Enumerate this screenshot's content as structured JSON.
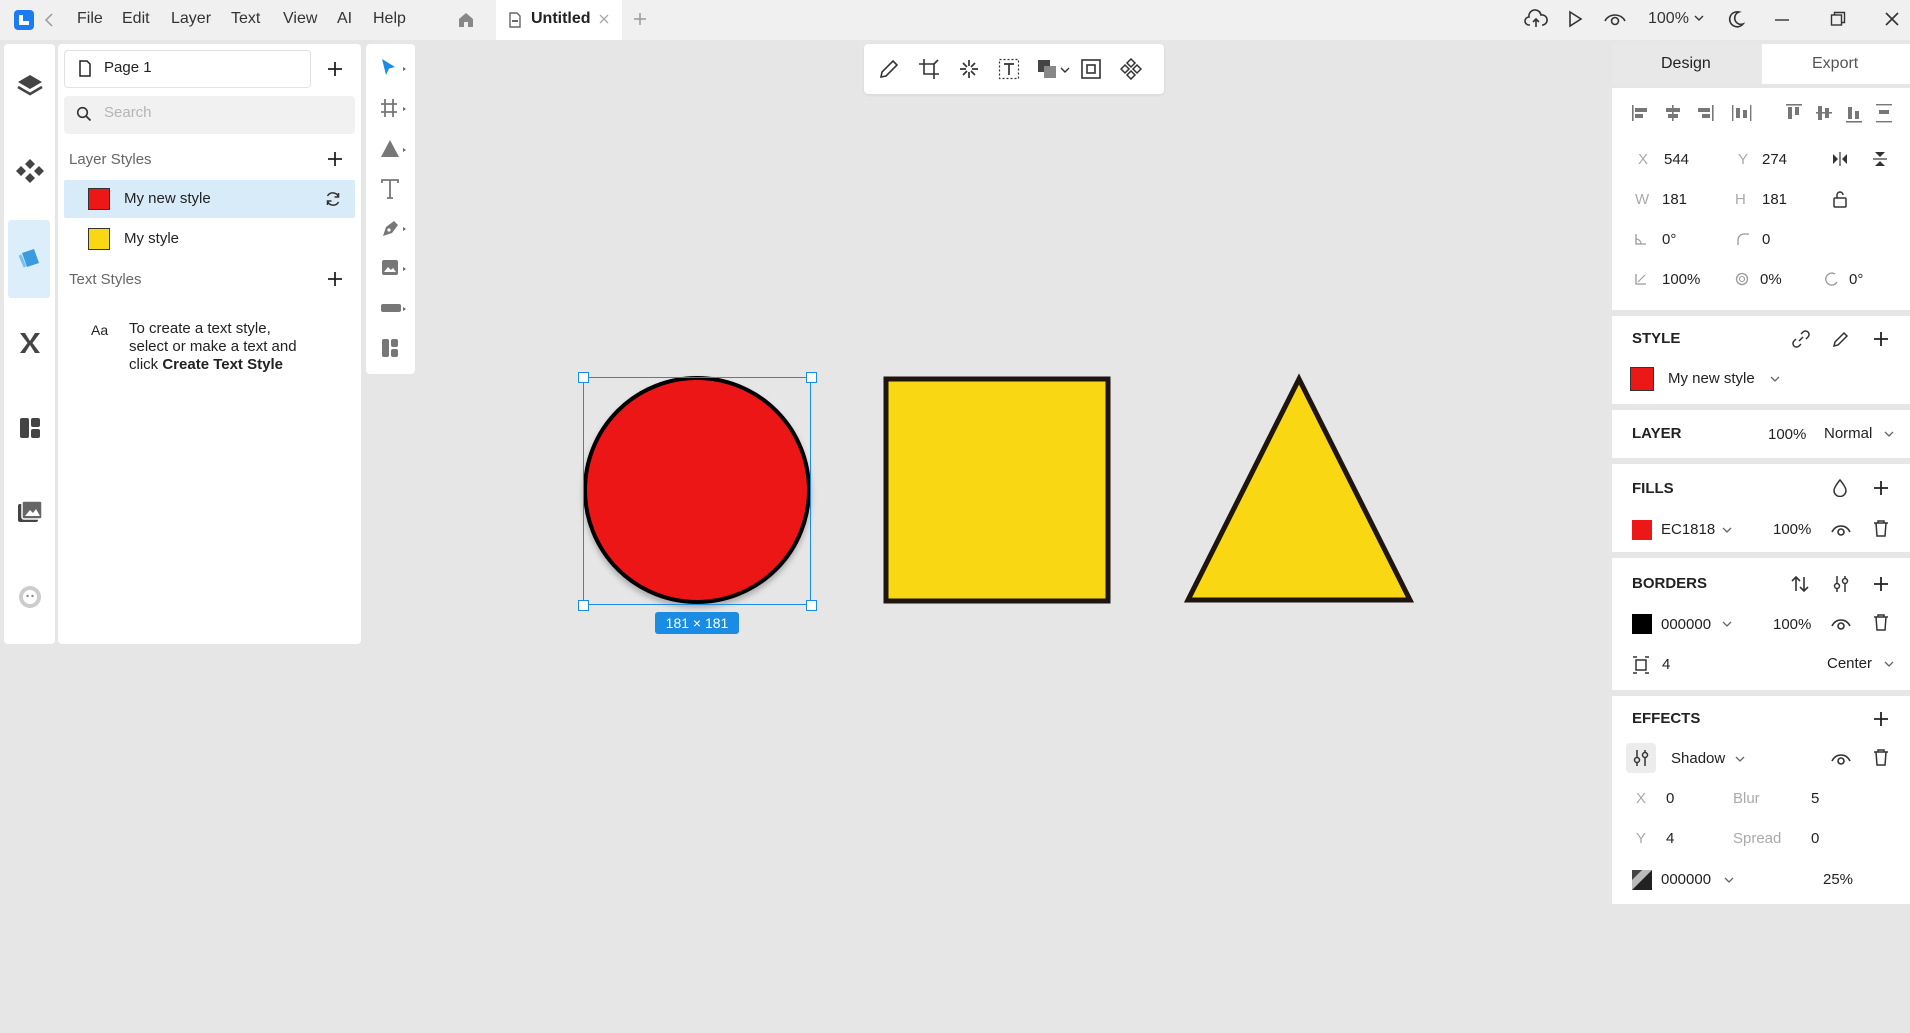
{
  "menu": [
    "File",
    "Edit",
    "Layer",
    "Text",
    "View",
    "AI",
    "Help"
  ],
  "tab": {
    "title": "Untitled"
  },
  "zoom": "100%",
  "left_panel": {
    "page": "Page 1",
    "search_placeholder": "Search",
    "layer_styles_heading": "Layer Styles",
    "layer_styles": [
      {
        "name": "My new style",
        "color": "#EC1818"
      },
      {
        "name": "My style",
        "color": "#F9D813"
      }
    ],
    "text_styles_heading": "Text Styles",
    "text_style_icon": "Aa",
    "help_line1": "To create a text style,",
    "help_line2": "select or make a text and",
    "help_line3_prefix": "click ",
    "help_line3_bold": "Create Text Style"
  },
  "canvas": {
    "selection_size": "181 × 181",
    "shapes": [
      {
        "kind": "circle",
        "fill": "#EC1818",
        "stroke": "#000000"
      },
      {
        "kind": "square",
        "fill": "#F9D813",
        "stroke": "#1e1410"
      },
      {
        "kind": "triangle",
        "fill": "#F9D813",
        "stroke": "#1e1410"
      }
    ]
  },
  "right_panel": {
    "tabs": [
      "Design",
      "Export"
    ],
    "geometry": {
      "x_label": "X",
      "x": "544",
      "y_label": "Y",
      "y": "274",
      "w_label": "W",
      "w": "181",
      "h_label": "H",
      "h": "181",
      "rotation": "0°",
      "radius": "0",
      "opacity": "100%",
      "blur": "0%",
      "angle": "0°"
    },
    "style": {
      "heading": "STYLE",
      "name": "My new style",
      "color": "#EC1818"
    },
    "layer": {
      "heading": "LAYER",
      "opacity": "100%",
      "blend": "Normal"
    },
    "fills": {
      "heading": "FILLS",
      "hex": "EC1818",
      "opacity": "100%",
      "color": "#EC1818"
    },
    "borders": {
      "heading": "BORDERS",
      "hex": "000000",
      "opacity": "100%",
      "width": "4",
      "position": "Center",
      "color": "#000000"
    },
    "effects": {
      "heading": "EFFECTS",
      "type": "Shadow",
      "x_label": "X",
      "x": "0",
      "blur_label": "Blur",
      "blur": "5",
      "y_label": "Y",
      "y": "4",
      "spread_label": "Spread",
      "spread": "0",
      "hex": "000000",
      "opacity": "25%"
    }
  }
}
